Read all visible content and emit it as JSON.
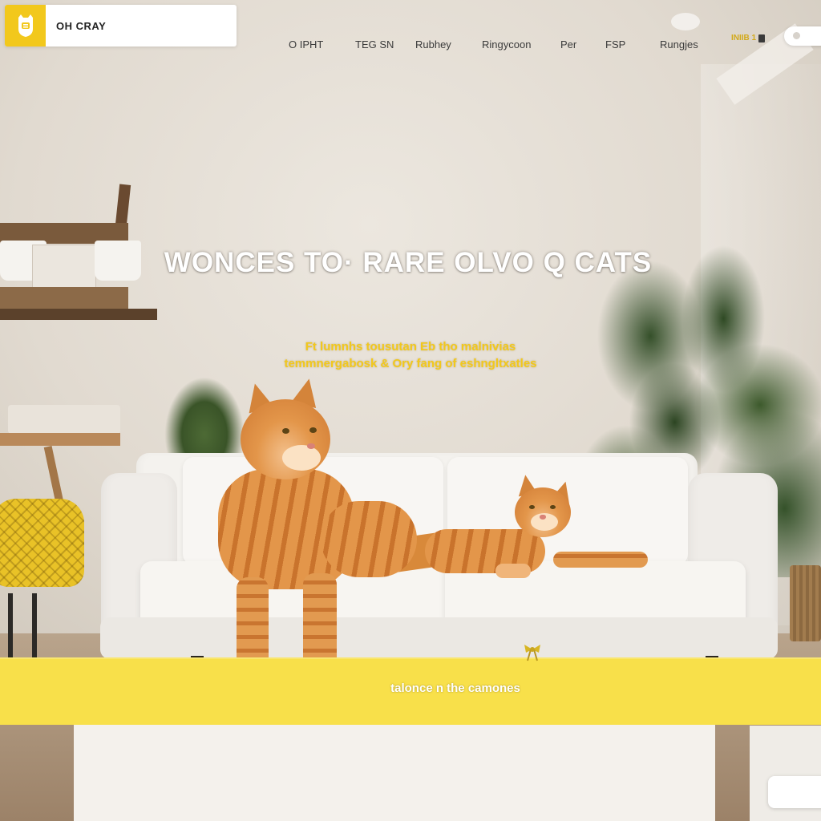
{
  "brand": {
    "logo_text": "OH CRAY",
    "logo_icon": "cat-badge-icon",
    "accent_color": "#f2c81c"
  },
  "nav": {
    "items": [
      {
        "label": "O IPHT"
      },
      {
        "label": "TEG SN"
      },
      {
        "label": "Rubhey"
      },
      {
        "label": "Ringycoon"
      },
      {
        "label": "Per"
      },
      {
        "label": "FSP"
      },
      {
        "label": "Rungjes"
      }
    ],
    "badge_label": "INIIB 1",
    "pill_button": "toggle-pill"
  },
  "hero": {
    "title": "WONCES TO· RARE OLVO Q CATS",
    "subtitle_line1": "Ft lumnhs tousutan Eb tho malnivias",
    "subtitle_line2": "temmnergabosk & Ory fang of eshngltxatles"
  },
  "band": {
    "label": "talonce n the camones",
    "background": "#f8e04a"
  }
}
